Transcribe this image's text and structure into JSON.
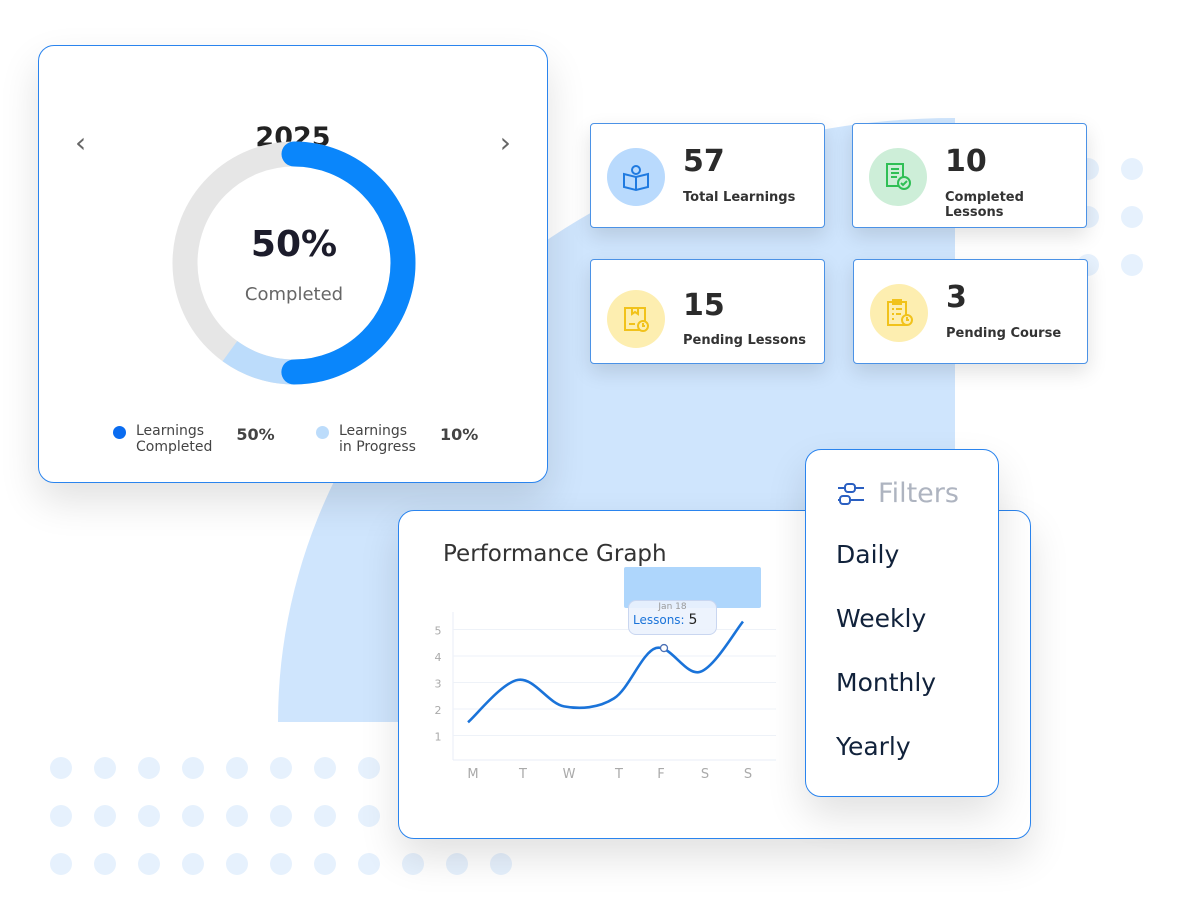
{
  "year_card": {
    "year": "2025",
    "prev_icon": "chevron-left-icon",
    "next_icon": "chevron-right-icon",
    "percent": "50%",
    "caption": "Completed",
    "completed_fraction": 0.5,
    "progress_fraction": 0.1,
    "legend": [
      {
        "label1": "Learnings",
        "label2": "Completed",
        "value": "50%",
        "color": "#0a6cf0"
      },
      {
        "label1": "Learnings",
        "label2": "in Progress",
        "value": "10%",
        "color": "#bcdcfb"
      }
    ]
  },
  "stats": [
    {
      "value": "57",
      "label": "Total Learnings",
      "icon": "book-reader-icon",
      "bg": "#b9dafd",
      "fg": "#1f7ae0"
    },
    {
      "value": "10",
      "label": "Completed Lessons",
      "icon": "document-check-icon",
      "bg": "#cdeed8",
      "fg": "#2fbf55"
    },
    {
      "value": "15",
      "label": "Pending Lessons",
      "icon": "box-clock-icon",
      "bg": "#fdeeb0",
      "fg": "#f1c21b"
    },
    {
      "value": "3",
      "label": "Pending Course",
      "icon": "clipboard-clock-icon",
      "bg": "#fdeeb0",
      "fg": "#f1c21b"
    }
  ],
  "graph": {
    "title": "Performance Graph",
    "tooltip": {
      "date": "Jan 18",
      "label": "Lessons:",
      "value": "5"
    }
  },
  "filters": {
    "title": "Filters",
    "icon": "sliders-icon",
    "items": [
      "Daily",
      "Weekly",
      "Monthly",
      "Yearly"
    ]
  },
  "chart_data": {
    "type": "line",
    "categories": [
      "M",
      "T",
      "W",
      "T",
      "F",
      "S",
      "S"
    ],
    "values": [
      1.5,
      3.1,
      2.1,
      2.4,
      4.3,
      3.4,
      5.3
    ],
    "ylim": [
      0,
      5
    ],
    "yticks": [
      1,
      2,
      3,
      4,
      5
    ],
    "grid": true,
    "color": "#1a73d9"
  }
}
